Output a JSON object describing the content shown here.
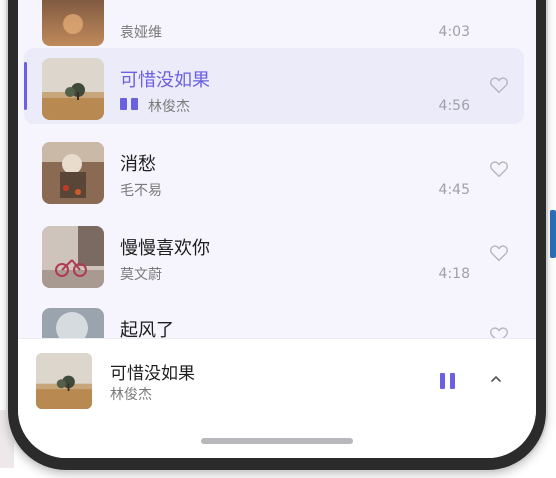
{
  "songs": [
    {
      "title": "",
      "artist": "袁娅维",
      "duration": "4:03",
      "active": false
    },
    {
      "title": "可惜没如果",
      "artist": "林俊杰",
      "duration": "4:56",
      "active": true
    },
    {
      "title": "消愁",
      "artist": "毛不易",
      "duration": "4:45",
      "active": false
    },
    {
      "title": "慢慢喜欢你",
      "artist": "莫文蔚",
      "duration": "4:18",
      "active": false
    },
    {
      "title": "起风了",
      "artist": "",
      "duration": "",
      "active": false
    }
  ],
  "now_playing": {
    "title": "可惜没如果",
    "artist": "林俊杰",
    "state": "playing"
  },
  "colors": {
    "accent": "#6b60e0",
    "active_row_bg": "#ecebfa",
    "list_bg": "#f6f4fc",
    "secondary_text": "#7a7a7a",
    "duration_text": "#a0a0a8"
  },
  "icons": {
    "like": "heart-outline-icon",
    "now_playing": "playing-bars-icon",
    "pause": "pause-icon",
    "expand": "chevron-up-icon"
  }
}
